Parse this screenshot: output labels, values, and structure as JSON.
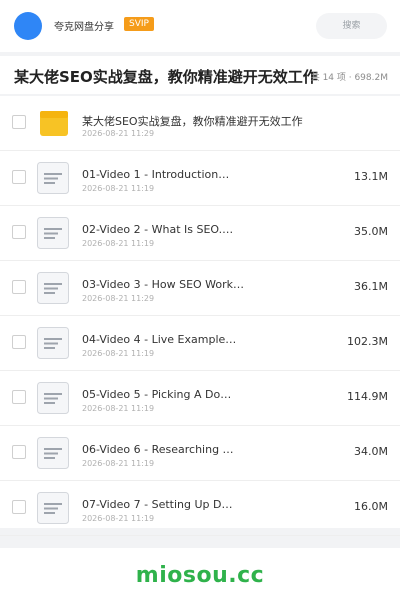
{
  "header": {
    "brand": "夸克网盘分享",
    "badge": "SVIP",
    "search_placeholder": "搜索"
  },
  "folder": {
    "title": "某大佬SEO实战复盘，教你精准避开无效工作",
    "meta": "共 14 项 · 698.2M"
  },
  "items": [
    {
      "name": "某大佬SEO实战复盘，教你精准避开无效工作",
      "date": "2026-08-21 11:29",
      "size": "",
      "kind": "folder"
    },
    {
      "name": "01-Video 1 - Introduction…",
      "date": "2026-08-21 11:19",
      "size": "13.1M",
      "kind": "file"
    },
    {
      "name": "02-Video 2 - What Is SEO.…",
      "date": "2026-08-21 11:19",
      "size": "35.0M",
      "kind": "file"
    },
    {
      "name": "03-Video 3 - How SEO Work…",
      "date": "2026-08-21 11:29",
      "size": "36.1M",
      "kind": "file"
    },
    {
      "name": "04-Video 4 - Live Example…",
      "date": "2026-08-21 11:19",
      "size": "102.3M",
      "kind": "file"
    },
    {
      "name": "05-Video 5 - Picking A Do…",
      "date": "2026-08-21 11:19",
      "size": "114.9M",
      "kind": "file"
    },
    {
      "name": "06-Video 6 - Researching …",
      "date": "2026-08-21 11:19",
      "size": "34.0M",
      "kind": "file"
    },
    {
      "name": "07-Video 7 - Setting Up D…",
      "date": "2026-08-21 11:19",
      "size": "16.0M",
      "kind": "file"
    }
  ],
  "watermark": "miosou.cc",
  "colors": {
    "accent": "#2f86f6",
    "badge": "#f59c1a",
    "watermark": "#2fb24b",
    "folder": "#f7c325"
  }
}
